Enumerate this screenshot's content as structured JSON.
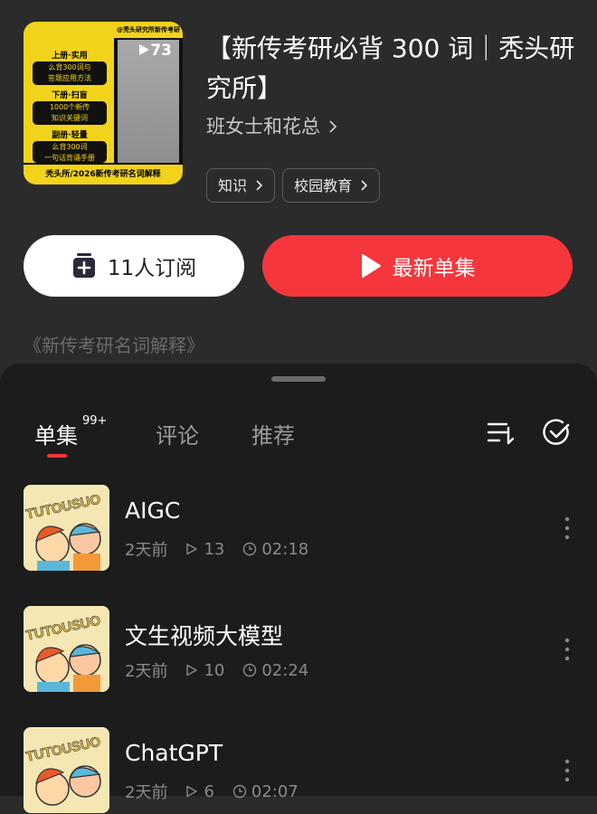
{
  "album": {
    "title": "【新传考研必背 300 词｜秃头研究所】",
    "author": "班女士和花总",
    "plays": "73",
    "tags": [
      "知识",
      "校园教育"
    ],
    "description": "《新传考研名词解释》",
    "cover": {
      "top_banner": "@秃头研究所新传考研",
      "rows": [
        "上册·实用",
        "下册·扫盲",
        "副册·轻量"
      ],
      "pills": [
        "么背300词与\n答题应用方法",
        "1000个新传\n知识关键词",
        "么背300词\n一句话背诵手册"
      ],
      "bottom": "秃头所/2026新传考研名词解释",
      "brand_color": "#f2d31b"
    }
  },
  "actions": {
    "subscribe_label": "11人订阅",
    "latest_label": "最新单集",
    "accent_color": "#f5363d"
  },
  "tabs": {
    "episodes": "单集",
    "episodes_count": "99+",
    "comments": "评论",
    "recommend": "推荐"
  },
  "episodes": [
    {
      "title": "AIGC",
      "date": "2天前",
      "plays": "13",
      "duration": "02:18"
    },
    {
      "title": "文生视频大模型",
      "date": "2天前",
      "plays": "10",
      "duration": "02:24"
    },
    {
      "title": "ChatGPT",
      "date": "2天前",
      "plays": "6",
      "duration": "02:07"
    }
  ],
  "thumb_text": "TUTOUSUO",
  "icons": {
    "subscribe": "plus-square-icon",
    "latest": "play-icon",
    "sort": "sort-icon",
    "select": "check-circle-icon",
    "more": "more-vertical-icon"
  }
}
